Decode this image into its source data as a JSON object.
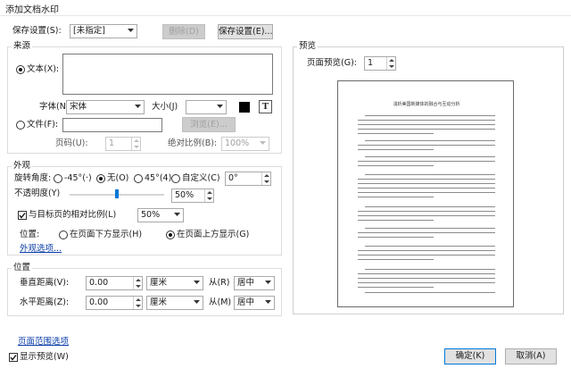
{
  "window": {
    "title": "添加文档水印"
  },
  "top": {
    "saved_settings_label": "保存设置(S):",
    "saved_settings_value": "[未指定]",
    "delete_label": "删除(D)",
    "save_settings_label": "保存设置(E)..."
  },
  "source": {
    "title": "来源",
    "text_label": "文本(X):",
    "text_value": "",
    "font_label": "字体(N):",
    "font_value": "宋体",
    "size_label": "大小(J)",
    "size_value": "",
    "color": "#000000",
    "file_label": "文件(F):",
    "file_value": "",
    "browse_label": "浏览(E)...",
    "page_label": "页码(U):",
    "page_value": "1",
    "abs_scale_label": "绝对比例(B):",
    "abs_scale_value": "100%"
  },
  "appearance": {
    "title": "外观",
    "rotation_label": "旋转角度:",
    "rot_neg45": "-45°(·)",
    "rot_none": "无(O)",
    "rot_45": "45°(4)",
    "rot_custom": "自定义(C)",
    "rot_custom_value": "0°",
    "rotation_selected": "none",
    "opacity_label": "不透明度(Y)",
    "opacity_value": "50%",
    "opacity_fraction": 0.5,
    "relative_scale_label": "与目标页的相对比例(L)",
    "relative_scale_checked": true,
    "relative_scale_value": "50%",
    "position_label": "位置:",
    "pos_below": "在页面下方显示(H)",
    "pos_above": "在页面上方显示(G)",
    "position_selected": "above",
    "more_options": "外观选项..."
  },
  "position": {
    "title": "位置",
    "vdist_label": "垂直距离(V):",
    "vdist_value": "0.00",
    "vunit": "厘米",
    "from_label_v": "从(R)",
    "vfrom": "居中",
    "hdist_label": "水平距离(Z):",
    "hdist_value": "0.00",
    "hunit": "厘米",
    "from_label_h": "从(M)",
    "hfrom": "居中"
  },
  "preview": {
    "title": "预览",
    "page_preview_label": "页面预览(G):",
    "page_value": "1",
    "doc_title": "浅析美国新媒体的融合与互动分析"
  },
  "bottom": {
    "page_range_link": "页面范围选项",
    "show_preview_label": "显示预览(W)",
    "show_preview_checked": true,
    "ok_label": "确定(K)",
    "cancel_label": "取消(A)"
  }
}
